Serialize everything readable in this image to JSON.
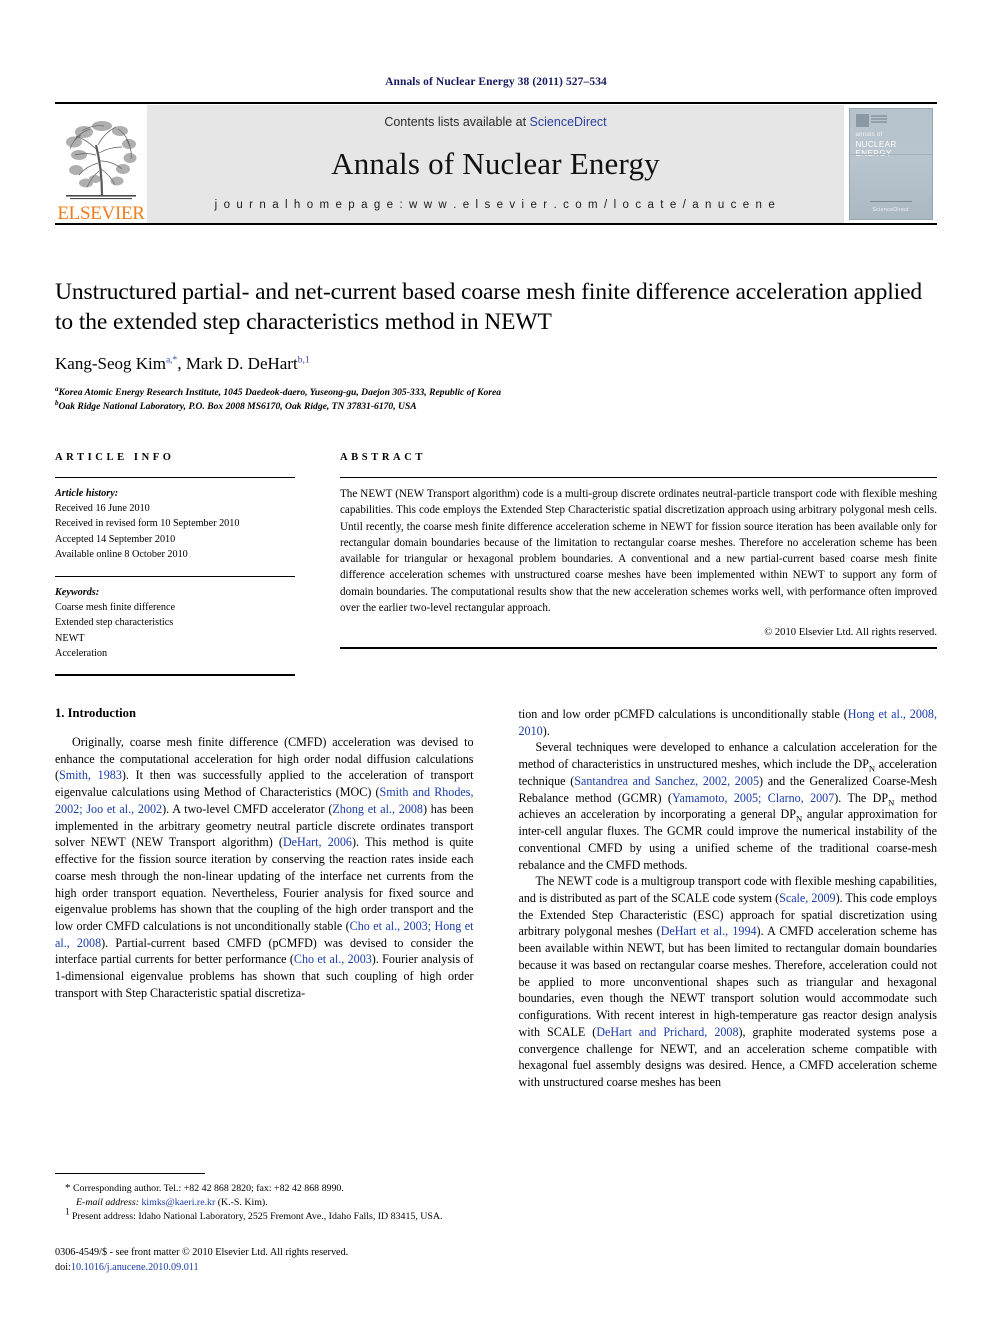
{
  "running_head": "Annals of Nuclear Energy 38 (2011) 527–534",
  "masthead": {
    "contents_prefix": "Contents lists available at ",
    "sciencedirect": "ScienceDirect",
    "journal_name": "Annals of Nuclear Energy",
    "homepage": "j o u r n a l   h o m e p a g e :   w w w . e l s e v i e r . c o m / l o c a t e / a n u c e n e",
    "publisher": "ELSEVIER",
    "cover": {
      "line1": "annals of",
      "line2": "NUCLEAR ENERGY",
      "footer": "ScienceDirect"
    }
  },
  "article": {
    "title": "Unstructured partial- and net-current based coarse mesh finite difference acceleration applied to the extended step characteristics method in NEWT",
    "authors": [
      {
        "name": "Kang-Seog Kim",
        "sup": "a,*"
      },
      {
        "name": "Mark D. DeHart",
        "sup": "b,1"
      }
    ],
    "authors_separator": ", ",
    "affiliations": [
      {
        "mark": "a",
        "text": "Korea Atomic Energy Research Institute, 1045 Daedeok-daero, Yuseong-gu, Daejon 305-333, Republic of Korea"
      },
      {
        "mark": "b",
        "text": "Oak Ridge National Laboratory, P.O. Box 2008 MS6170, Oak Ridge, TN 37831-6170, USA"
      }
    ]
  },
  "article_info": {
    "heading": "ARTICLE INFO",
    "history_label": "Article history:",
    "history": [
      "Received 16 June 2010",
      "Received in revised form 10 September 2010",
      "Accepted 14 September 2010",
      "Available online 8 October 2010"
    ],
    "keywords_label": "Keywords:",
    "keywords": [
      "Coarse mesh finite difference",
      "Extended step characteristics",
      "NEWT",
      "Acceleration"
    ]
  },
  "abstract": {
    "heading": "ABSTRACT",
    "text": "The NEWT (NEW Transport algorithm) code is a multi-group discrete ordinates neutral-particle transport code with flexible meshing capabilities. This code employs the Extended Step Characteristic spatial discretization approach using arbitrary polygonal mesh cells. Until recently, the coarse mesh finite difference acceleration scheme in NEWT for fission source iteration has been available only for rectangular domain boundaries because of the limitation to rectangular coarse meshes. Therefore no acceleration scheme has been available for triangular or hexagonal problem boundaries. A conventional and a new partial-current based coarse mesh finite difference acceleration schemes with unstructured coarse meshes have been implemented within NEWT to support any form of domain boundaries. The computational results show that the new acceleration schemes works well, with performance often improved over the earlier two-level rectangular approach.",
    "copyright": "© 2010 Elsevier Ltd. All rights reserved."
  },
  "body": {
    "section_title": "1. Introduction",
    "left_column": {
      "p1_parts": [
        {
          "t": "Originally, coarse mesh finite difference (CMFD) acceleration was devised to enhance the computational acceleration for high order nodal diffusion calculations (",
          "c": false
        },
        {
          "t": "Smith, 1983",
          "c": true
        },
        {
          "t": "). It then was successfully applied to the acceleration of transport eigenvalue calculations using Method of Characteristics (MOC) (",
          "c": false
        },
        {
          "t": "Smith and Rhodes, 2002; Joo et al., 2002",
          "c": true
        },
        {
          "t": "). A two-level CMFD accelerator (",
          "c": false
        },
        {
          "t": "Zhong et al., 2008",
          "c": true
        },
        {
          "t": ") has been implemented in the arbitrary geometry neutral particle discrete ordinates transport solver NEWT (NEW Transport algorithm) (",
          "c": false
        },
        {
          "t": "DeHart, 2006",
          "c": true
        },
        {
          "t": "). This method is quite effective for the fission source iteration by conserving the reaction rates inside each coarse mesh through the non-linear updating of the interface net currents from the high order transport equation. Nevertheless, Fourier analysis for fixed source and eigenvalue problems has shown that the coupling of the high order transport and the low order CMFD calculations is not unconditionally stable (",
          "c": false
        },
        {
          "t": "Cho et al., 2003; Hong et al., 2008",
          "c": true
        },
        {
          "t": "). Partial-current based CMFD (pCMFD) was devised to consider the interface partial currents for better performance (",
          "c": false
        },
        {
          "t": "Cho et al., 2003",
          "c": true
        },
        {
          "t": "). Fourier analysis of 1-dimensional eigenvalue problems has shown that such coupling of high order transport with Step Characteristic spatial discretiza-",
          "c": false
        }
      ]
    },
    "right_column": {
      "p1_parts": [
        {
          "t": "tion and low order pCMFD calculations is unconditionally stable (",
          "c": false
        },
        {
          "t": "Hong et al., 2008, 2010",
          "c": true
        },
        {
          "t": ").",
          "c": false
        }
      ],
      "p2_parts": [
        {
          "t": "Several techniques were developed to enhance a calculation acceleration for the method of characteristics in unstructured meshes, which include the DP",
          "c": false
        },
        {
          "t": "N",
          "c": false,
          "sub": true
        },
        {
          "t": " acceleration technique (",
          "c": false
        },
        {
          "t": "Santandrea and Sanchez, 2002, 2005",
          "c": true
        },
        {
          "t": ") and the Generalized Coarse-Mesh Rebalance method (GCMR) (",
          "c": false
        },
        {
          "t": "Yamamoto, 2005; Clarno, 2007",
          "c": true
        },
        {
          "t": "). The DP",
          "c": false
        },
        {
          "t": "N",
          "c": false,
          "sub": true
        },
        {
          "t": " method achieves an acceleration by incorporating a general DP",
          "c": false
        },
        {
          "t": "N",
          "c": false,
          "sub": true
        },
        {
          "t": " angular approximation for inter-cell angular fluxes. The GCMR could improve the numerical instability of the conventional CMFD by using a unified scheme of the traditional coarse-mesh rebalance and the CMFD methods.",
          "c": false
        }
      ],
      "p3_parts": [
        {
          "t": "The NEWT code is a multigroup transport code with flexible meshing capabilities, and is distributed as part of the SCALE code system (",
          "c": false
        },
        {
          "t": "Scale, 2009",
          "c": true
        },
        {
          "t": "). This code employs the Extended Step Characteristic (ESC) approach for spatial discretization using arbitrary polygonal meshes (",
          "c": false
        },
        {
          "t": "DeHart et al., 1994",
          "c": true
        },
        {
          "t": "). A CMFD acceleration scheme has been available within NEWT, but has been limited to rectangular domain boundaries because it was based on rectangular coarse meshes. Therefore, acceleration could not be applied to more unconventional shapes such as triangular and hexagonal boundaries, even though the NEWT transport solution would accommodate such configurations. With recent interest in high-temperature gas reactor design analysis with SCALE (",
          "c": false
        },
        {
          "t": "DeHart and Prichard, 2008",
          "c": true
        },
        {
          "t": "), graphite moderated systems pose a convergence challenge for NEWT, and an acceleration scheme compatible with hexagonal fuel assembly designs was desired. Hence, a CMFD acceleration scheme with unstructured coarse meshes has been",
          "c": false
        }
      ]
    }
  },
  "footnotes": {
    "corresponding": "Corresponding author. Tel.: +82 42 868 2820; fax: +82 42 868 8990.",
    "email_label": "E-mail address:",
    "email": "kimks@kaeri.re.kr",
    "email_suffix": " (K.-S. Kim).",
    "present_address_label": "Present address:",
    "present_address": " Idaho National Laboratory, 2525 Fremont Ave., Idaho Falls, ID 83415, USA.",
    "issn_line": "0306-4549/$ - see front matter © 2010 Elsevier Ltd. All rights reserved.",
    "doi_label": "doi:",
    "doi": "10.1016/j.anucene.2010.09.011"
  }
}
